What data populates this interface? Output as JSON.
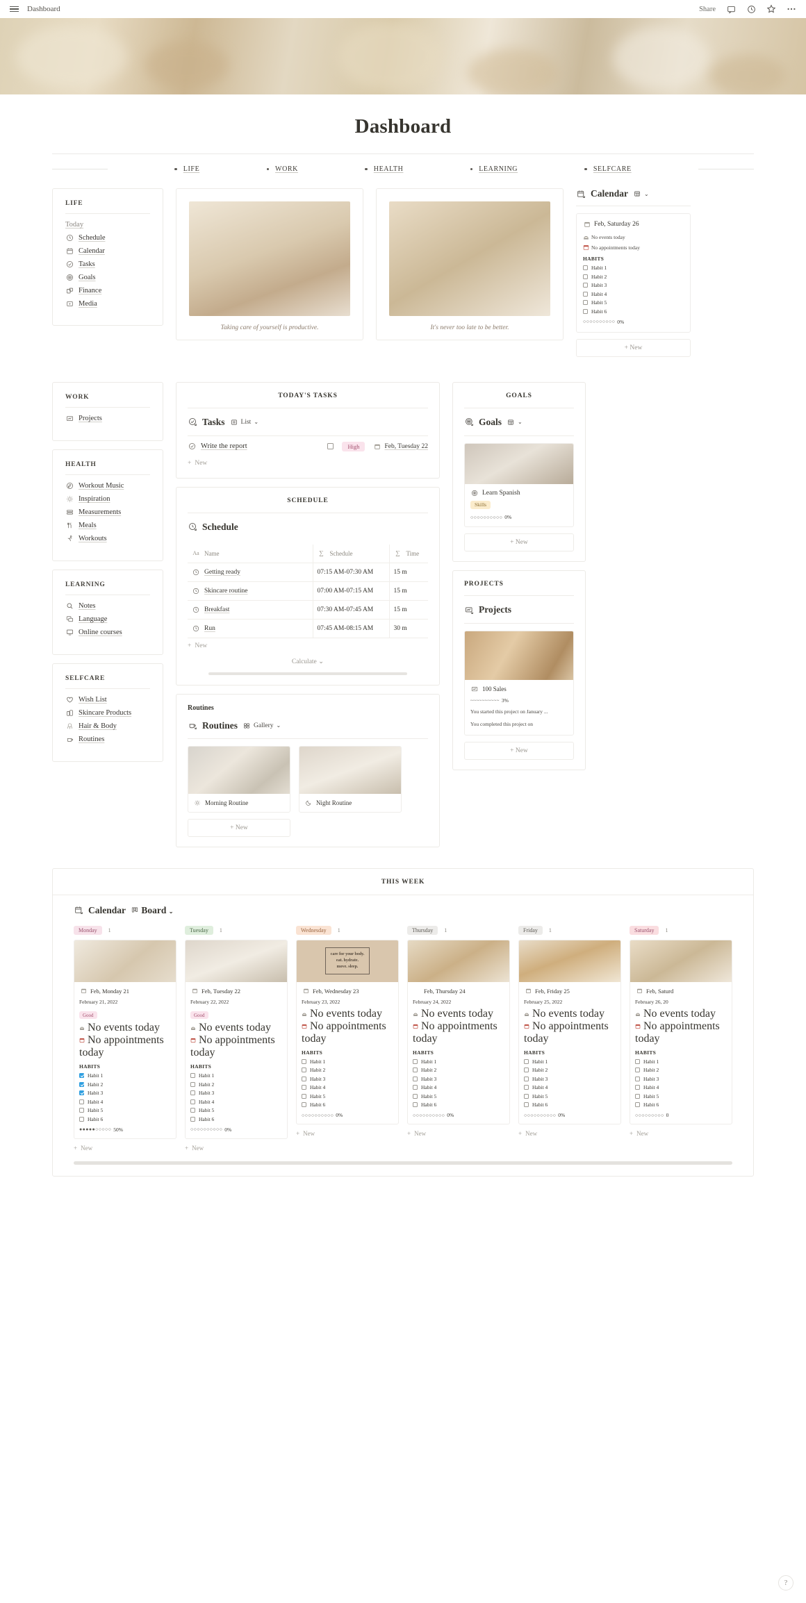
{
  "topbar": {
    "breadcrumb": "Dashboard",
    "share_label": "Share",
    "icons": [
      "comment-icon",
      "clock-icon",
      "star-icon",
      "more-options-icon"
    ]
  },
  "page": {
    "title": "Dashboard"
  },
  "nav": {
    "links": [
      {
        "label": "LIFE"
      },
      {
        "label": "WORK"
      },
      {
        "label": "HEALTH"
      },
      {
        "label": "LEARNING"
      },
      {
        "label": "SELFCARE"
      }
    ]
  },
  "life_card": {
    "title": "LIFE",
    "today_label": "Today",
    "items": [
      {
        "label": "Schedule",
        "icon": "clock-icon"
      },
      {
        "label": "Calendar",
        "icon": "calendar-icon"
      },
      {
        "label": "Tasks",
        "icon": "check-circle-icon"
      },
      {
        "label": "Goals",
        "icon": "target-icon"
      },
      {
        "label": "Finance",
        "icon": "finance-icon"
      },
      {
        "label": "Media",
        "icon": "media-icon"
      }
    ]
  },
  "quotes": [
    {
      "text": "Taking care of yourself is productive."
    },
    {
      "text": "It's never too late to be better."
    }
  ],
  "calendar_widget": {
    "db_title": "Calendar",
    "db_icon": "calendar-link-icon",
    "view_label": "",
    "view_icon": "table-view-icon",
    "entry": {
      "date_title": "Feb, Saturday 26",
      "events_text": "No events today",
      "appointments_text": "No appointments today",
      "habits_header": "HABITS",
      "habits": [
        {
          "label": "Habit 1",
          "checked": false
        },
        {
          "label": "Habit 2",
          "checked": false
        },
        {
          "label": "Habit 3",
          "checked": false
        },
        {
          "label": "Habit 4",
          "checked": false
        },
        {
          "label": "Habit 5",
          "checked": false
        },
        {
          "label": "Habit 6",
          "checked": false
        }
      ],
      "progress_dots": "○○○○○○○○○○",
      "progress_label": "0%"
    },
    "new_label": "New"
  },
  "work_card": {
    "title": "WORK",
    "items": [
      {
        "label": "Projects",
        "icon": "projects-icon"
      }
    ]
  },
  "health_card": {
    "title": "HEALTH",
    "items": [
      {
        "label": "Workout Music",
        "icon": "music-icon"
      },
      {
        "label": "Inspiration",
        "icon": "sun-icon"
      },
      {
        "label": "Measurements",
        "icon": "measurements-icon"
      },
      {
        "label": "Meals",
        "icon": "meals-icon"
      },
      {
        "label": "Workouts",
        "icon": "workouts-icon"
      }
    ]
  },
  "learning_card": {
    "title": "LEARNING",
    "items": [
      {
        "label": "Notes",
        "icon": "search-icon"
      },
      {
        "label": "Language",
        "icon": "language-icon"
      },
      {
        "label": "Online courses",
        "icon": "computer-icon"
      }
    ]
  },
  "selfcare_card": {
    "title": "SELFCARE",
    "items": [
      {
        "label": "Wish List",
        "icon": "heart-icon"
      },
      {
        "label": "Skincare Products",
        "icon": "skincare-icon"
      },
      {
        "label": "Hair & Body",
        "icon": "hair-icon"
      },
      {
        "label": "Routines",
        "icon": "routines-icon"
      }
    ]
  },
  "tasks_panel": {
    "header": "TODAY'S TASKS",
    "db_title": "Tasks",
    "db_icon": "check-circle-link-icon",
    "view_label": "List",
    "view_icon": "list-view-icon",
    "rows": [
      {
        "name": "Write the report",
        "checked": false,
        "priority": "High",
        "date": "Feb, Tuesday 22"
      }
    ],
    "new_label": "New"
  },
  "schedule_panel": {
    "header": "SCHEDULE",
    "db_title": "Schedule",
    "db_icon": "clock-link-icon",
    "columns": [
      {
        "label": "Name",
        "icon": "text-type-icon"
      },
      {
        "label": "Schedule",
        "icon": "formula-icon"
      },
      {
        "label": "Time",
        "icon": "formula-icon"
      }
    ],
    "rows": [
      {
        "name": "Getting ready",
        "schedule": "07:15 AM-07:30 AM",
        "time": "15 m"
      },
      {
        "name": "Skincare routine",
        "schedule": "07:00 AM-07:15 AM",
        "time": "15 m"
      },
      {
        "name": "Breakfast",
        "schedule": "07:30 AM-07:45 AM",
        "time": "15 m"
      },
      {
        "name": "Run",
        "schedule": "07:45 AM-08:15 AM",
        "time": "30 m"
      }
    ],
    "new_label": "New",
    "calculate_label": "Calculate"
  },
  "routines_panel": {
    "header": "Routines",
    "db_title": "Routines",
    "db_icon": "routines-link-icon",
    "view_label": "Gallery",
    "view_icon": "gallery-view-icon",
    "cards": [
      {
        "label": "Morning Routine",
        "icon": "sun-icon"
      },
      {
        "label": "Night Routine",
        "icon": "moon-icon"
      }
    ],
    "new_label": "New"
  },
  "goals_panel": {
    "header": "GOALS",
    "db_title": "Goals",
    "db_icon": "target-link-icon",
    "view_icon": "table-view-icon",
    "cards": [
      {
        "title": "Learn Spanish",
        "icon": "target-icon",
        "tag": "Skills",
        "progress_dots": "○○○○○○○○○○",
        "progress_label": "0%"
      }
    ],
    "new_label": "New"
  },
  "projects_panel": {
    "header": "PROJECTS",
    "db_title": "Projects",
    "db_icon": "projects-link-icon",
    "cards": [
      {
        "title": "100 Sales",
        "icon": "projects-icon",
        "progress_dots": "~~~~~~~~~~",
        "progress_label": "3%",
        "line1": "You started this project on January ...",
        "line2": "You completed this project on"
      }
    ],
    "new_label": "New"
  },
  "week_board": {
    "header": "THIS WEEK",
    "db_title": "Calendar",
    "db_icon": "calendar-link-icon",
    "view_label": "Board",
    "view_icon": "board-view-icon",
    "habits_header": "HABITS",
    "events_text": "No events today",
    "appointments_text": "No appointments today",
    "new_label": "New",
    "columns": [
      {
        "day": "Monday",
        "count": "1",
        "tag_color": "#f7e2ea",
        "date_title": "Feb, Monday 21",
        "date_sub": "February 21, 2022",
        "mood": "Good",
        "habits": [
          {
            "label": "Habit 1",
            "checked": true
          },
          {
            "label": "Habit 2",
            "checked": true
          },
          {
            "label": "Habit 3",
            "checked": true
          },
          {
            "label": "Habit 4",
            "checked": false
          },
          {
            "label": "Habit 5",
            "checked": false
          },
          {
            "label": "Habit 6",
            "checked": false
          }
        ],
        "progress_dots": "●●●●●○○○○○",
        "progress_label": "50%"
      },
      {
        "day": "Tuesday",
        "count": "1",
        "tag_color": "#dfeedd",
        "date_title": "Feb, Tuesday 22",
        "date_sub": "February 22, 2022",
        "mood": "Good",
        "habits": [
          {
            "label": "Habit 1",
            "checked": false
          },
          {
            "label": "Habit 2",
            "checked": false
          },
          {
            "label": "Habit 3",
            "checked": false
          },
          {
            "label": "Habit 4",
            "checked": false
          },
          {
            "label": "Habit 5",
            "checked": false
          },
          {
            "label": "Habit 6",
            "checked": false
          }
        ],
        "progress_dots": "○○○○○○○○○○",
        "progress_label": "0%"
      },
      {
        "day": "Wednesday",
        "count": "1",
        "tag_color": "#fae3d3",
        "date_title": "Feb, Wednesday 23",
        "date_sub": "February 23, 2022",
        "mood": "",
        "habits": [
          {
            "label": "Habit 1",
            "checked": false
          },
          {
            "label": "Habit 2",
            "checked": false
          },
          {
            "label": "Habit 3",
            "checked": false
          },
          {
            "label": "Habit 4",
            "checked": false
          },
          {
            "label": "Habit 5",
            "checked": false
          },
          {
            "label": "Habit 6",
            "checked": false
          }
        ],
        "progress_dots": "○○○○○○○○○○",
        "progress_label": "0%"
      },
      {
        "day": "Thursday",
        "count": "1",
        "tag_color": "#ecebe9",
        "date_title": "Feb, Thursday 24",
        "date_sub": "February 24, 2022",
        "mood": "",
        "habits": [
          {
            "label": "Habit 1",
            "checked": false
          },
          {
            "label": "Habit 2",
            "checked": false
          },
          {
            "label": "Habit 3",
            "checked": false
          },
          {
            "label": "Habit 4",
            "checked": false
          },
          {
            "label": "Habit 5",
            "checked": false
          },
          {
            "label": "Habit 6",
            "checked": false
          }
        ],
        "progress_dots": "○○○○○○○○○○",
        "progress_label": "0%"
      },
      {
        "day": "Friday",
        "count": "1",
        "tag_color": "#ecebe9",
        "date_title": "Feb, Friday 25",
        "date_sub": "February 25, 2022",
        "mood": "",
        "habits": [
          {
            "label": "Habit 1",
            "checked": false
          },
          {
            "label": "Habit 2",
            "checked": false
          },
          {
            "label": "Habit 3",
            "checked": false
          },
          {
            "label": "Habit 4",
            "checked": false
          },
          {
            "label": "Habit 5",
            "checked": false
          },
          {
            "label": "Habit 6",
            "checked": false
          }
        ],
        "progress_dots": "○○○○○○○○○○",
        "progress_label": "0%"
      },
      {
        "day": "Saturday",
        "count": "1",
        "tag_color": "#fadde0",
        "date_title": "Feb, Saturd",
        "date_sub": "February 26, 20",
        "mood": "",
        "habits": [
          {
            "label": "Habit 1",
            "checked": false
          },
          {
            "label": "Habit 2",
            "checked": false
          },
          {
            "label": "Habit 3",
            "checked": false
          },
          {
            "label": "Habit 4",
            "checked": false
          },
          {
            "label": "Habit 5",
            "checked": false
          },
          {
            "label": "Habit 6",
            "checked": false
          }
        ],
        "progress_dots": "○○○○○○○○○",
        "progress_label": "0"
      }
    ]
  },
  "help": {
    "label": "?"
  }
}
